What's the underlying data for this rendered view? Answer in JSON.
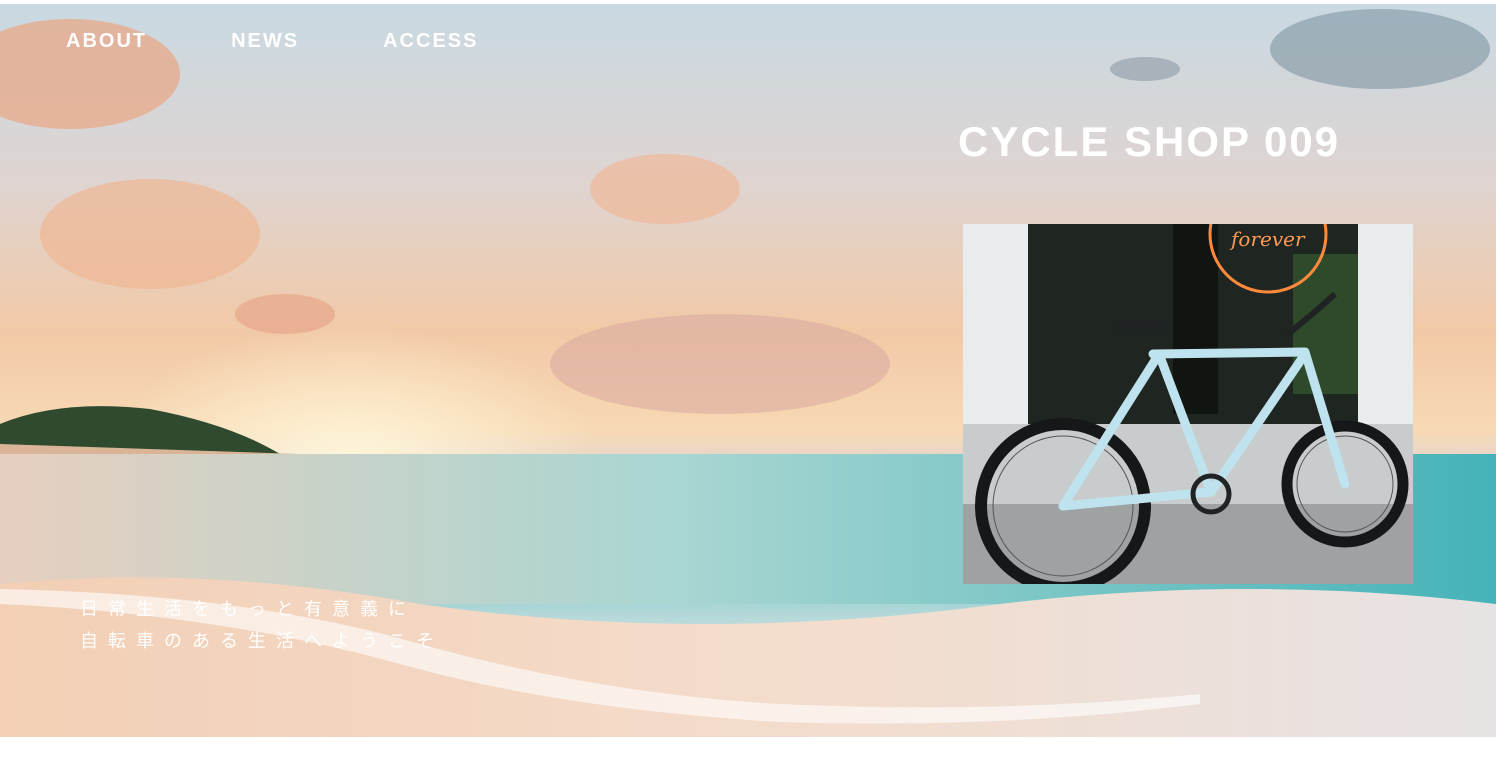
{
  "nav": {
    "items": [
      {
        "label": "ABOUT"
      },
      {
        "label": "NEWS"
      },
      {
        "label": "ACCESS"
      }
    ]
  },
  "hero": {
    "brand_title": "CYCLE SHOP 009",
    "tagline_line1": "日常生活をもっと有意義に",
    "tagline_line2": "自転車のある生活へようこそ",
    "background": "sunset-beach-photo",
    "photo": "bicycle-in-front-of-shop-photo"
  },
  "colors": {
    "text": "#ffffff",
    "sea": "#6fc4c7",
    "sunset": "#f7d9b4",
    "neon": "#ff8a3d",
    "bike_frame": "#bfe3ee"
  }
}
